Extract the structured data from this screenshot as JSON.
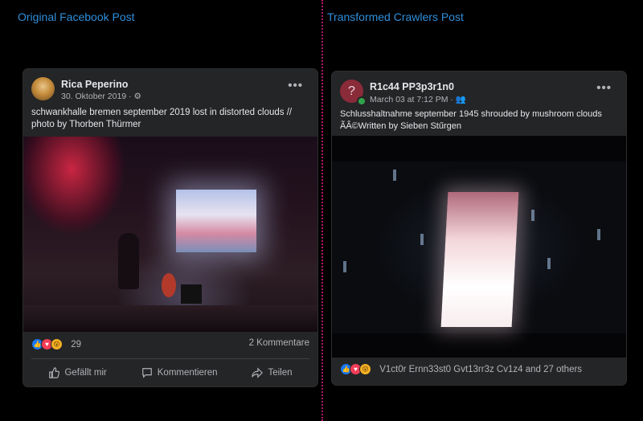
{
  "titles": {
    "left": "Original Facebook Post",
    "right": "Transformed Crawlers Post"
  },
  "left_post": {
    "author": "Rica Peperino",
    "meta": "30. Oktober 2019 · ⚙",
    "text": "schwankhalle bremen september 2019 lost in distorted clouds   //  photo by Thorben Thürmer",
    "reaction_count": "29",
    "comments": "2 Kommentare",
    "actions": [
      "Gefällt mir",
      "Kommentieren",
      "Teilen"
    ]
  },
  "right_post": {
    "author": "R1c44 PP3p3r1n0",
    "meta": "March 03 at 7:12 PM · 👥",
    "text": "Schlusshaltnahme september 1945 shrouded by mushroom clouds ÃÂ©Written by Sieben Stűrgen",
    "reactions_text": "V1ct0r Ernn33st0 Gvt13rr3z Cv1z4 and 27 others"
  },
  "icons": [
    "like-icon",
    "love-icon",
    "wow-icon",
    "comment-icon",
    "share-icon",
    "more-icon",
    "globe-icon",
    "friends-icon"
  ],
  "colors": {
    "title_blue": "#2f8fdc",
    "divider_magenta": "#b2176b",
    "card_bg": "#242526"
  }
}
